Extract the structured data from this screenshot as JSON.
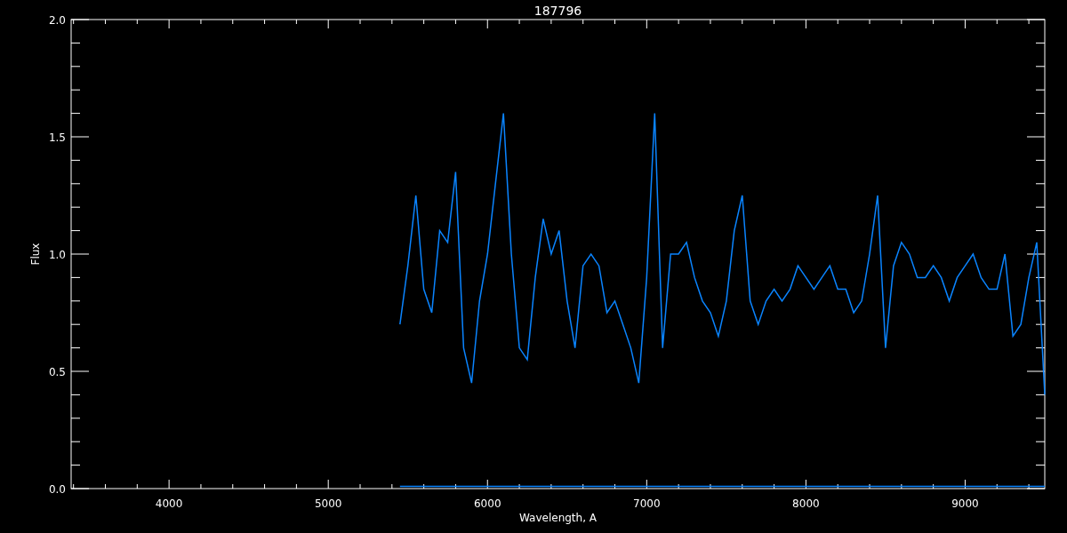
{
  "chart_data": {
    "type": "line",
    "title": "187796",
    "xlabel": "Wavelength, A",
    "ylabel": "Flux",
    "xlim": [
      3385,
      9500
    ],
    "ylim": [
      0,
      2
    ],
    "xticks": [
      4000,
      5000,
      6000,
      7000,
      8000,
      9000
    ],
    "yticks": [
      {
        "value": 0,
        "label": "0.0"
      },
      {
        "value": 0.5,
        "label": "0.5"
      },
      {
        "value": 1,
        "label": "1.0"
      },
      {
        "value": 1.5,
        "label": "1.5"
      },
      {
        "value": 2,
        "label": "2.0"
      }
    ],
    "x": [
      5450,
      5500,
      5550,
      5600,
      5650,
      5700,
      5750,
      5800,
      5850,
      5900,
      5950,
      6000,
      6050,
      6100,
      6150,
      6200,
      6250,
      6300,
      6350,
      6400,
      6450,
      6500,
      6550,
      6600,
      6650,
      6700,
      6750,
      6800,
      6850,
      6900,
      6950,
      7000,
      7050,
      7100,
      7150,
      7200,
      7250,
      7300,
      7350,
      7400,
      7450,
      7500,
      7550,
      7600,
      7650,
      7700,
      7750,
      7800,
      7850,
      7900,
      7950,
      8000,
      8050,
      8100,
      8150,
      8200,
      8250,
      8300,
      8350,
      8400,
      8450,
      8500,
      8550,
      8600,
      8650,
      8700,
      8750,
      8800,
      8850,
      8900,
      8950,
      9000,
      9050,
      9100,
      9150,
      9200,
      9250,
      9300,
      9350,
      9400,
      9450,
      9500
    ],
    "series": [
      {
        "color": "#0a84ff",
        "values": [
          0.7,
          0.95,
          1.25,
          0.85,
          0.75,
          1.1,
          1.05,
          1.35,
          0.6,
          0.45,
          0.8,
          1.0,
          1.3,
          1.6,
          1.0,
          0.6,
          0.55,
          0.9,
          1.15,
          1.0,
          1.1,
          0.8,
          0.6,
          0.95,
          1.0,
          0.95,
          0.75,
          0.8,
          0.7,
          0.6,
          0.45,
          0.9,
          1.6,
          0.6,
          1.0,
          1.0,
          1.05,
          0.9,
          0.8,
          0.75,
          0.65,
          0.8,
          1.1,
          1.25,
          0.8,
          0.7,
          0.8,
          0.85,
          0.8,
          0.85,
          0.95,
          0.9,
          0.85,
          0.9,
          0.95,
          0.85,
          0.85,
          0.75,
          0.8,
          1.0,
          1.25,
          0.6,
          0.95,
          1.05,
          1.0,
          0.9,
          0.9,
          0.95,
          0.9,
          0.8,
          0.9,
          0.95,
          1.0,
          0.9,
          0.85,
          0.85,
          1.0,
          0.65,
          0.7,
          0.9,
          1.05,
          0.4
        ]
      },
      {
        "color": "#0a84ff",
        "values": [
          0.01,
          0.01,
          0.01,
          0.01,
          0.01,
          0.01,
          0.01,
          0.01,
          0.01,
          0.01,
          0.01,
          0.01,
          0.01,
          0.01,
          0.01,
          0.01,
          0.01,
          0.01,
          0.01,
          0.01,
          0.01,
          0.01,
          0.01,
          0.01,
          0.01,
          0.01,
          0.01,
          0.01,
          0.01,
          0.01,
          0.01,
          0.01,
          0.01,
          0.01,
          0.01,
          0.01,
          0.01,
          0.01,
          0.01,
          0.01,
          0.01,
          0.01,
          0.01,
          0.01,
          0.01,
          0.01,
          0.01,
          0.01,
          0.01,
          0.01,
          0.01,
          0.01,
          0.01,
          0.01,
          0.01,
          0.01,
          0.01,
          0.01,
          0.01,
          0.01,
          0.01,
          0.01,
          0.01,
          0.01,
          0.01,
          0.01,
          0.01,
          0.01,
          0.01,
          0.01,
          0.01,
          0.01,
          0.01,
          0.01,
          0.01,
          0.01,
          0.01,
          0.01,
          0.01,
          0.01,
          0.01,
          0.01
        ]
      }
    ]
  }
}
